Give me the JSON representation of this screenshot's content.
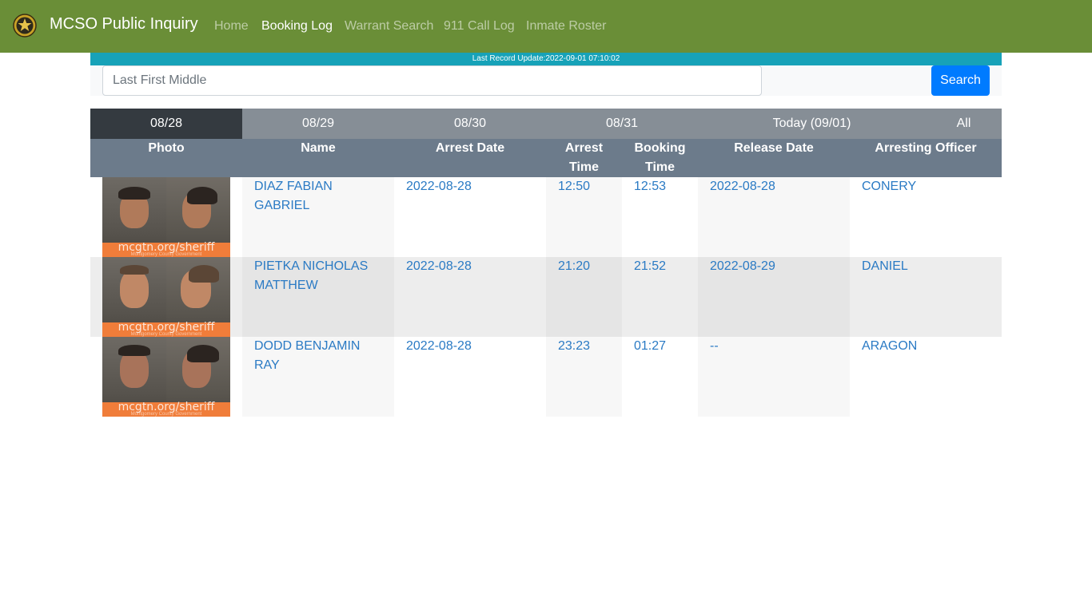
{
  "navbar": {
    "brand": "MCSO Public Inquiry",
    "logo_icon": "sheriff-star-badge-icon",
    "links": [
      "Home",
      "Booking Log",
      "Warrant Search",
      "911 Call Log",
      "Inmate Roster"
    ],
    "active_link": "Booking Log",
    "color": "#6a8e37"
  },
  "update_bar": {
    "text": "Last Record Update:2022-09-01 07:10:02",
    "color": "#17a2b8"
  },
  "search": {
    "placeholder": "Last First Middle",
    "value": "",
    "button_label": "Search",
    "button_color": "#007bff"
  },
  "date_tabs": {
    "items": [
      "08/28",
      "08/29",
      "08/30",
      "08/31",
      "Today (09/01)",
      "All"
    ],
    "active": "08/28"
  },
  "table": {
    "headers": [
      "Photo",
      "Name",
      "Arrest Date",
      "Arrest Time",
      "Booking Time",
      "Release Date",
      "Arresting Officer"
    ],
    "rows": [
      {
        "name": "DIAZ FABIAN GABRIEL",
        "arrest_date": "2022-08-28",
        "arrest_time": "12:50",
        "booking_time": "12:53",
        "release_date": "2022-08-28",
        "officer": "CONERY"
      },
      {
        "name": "PIETKA NICHOLAS MATTHEW",
        "arrest_date": "2022-08-28",
        "arrest_time": "21:20",
        "booking_time": "21:52",
        "release_date": "2022-08-29",
        "officer": "DANIEL"
      },
      {
        "name": "DODD BENJAMIN RAY",
        "arrest_date": "2022-08-28",
        "arrest_time": "23:23",
        "booking_time": "01:27",
        "release_date": "--",
        "officer": "ARAGON"
      }
    ],
    "photo_watermark": "mcgtn.org/sheriff",
    "photo_watermark_sub": "Montgomery County Government"
  }
}
